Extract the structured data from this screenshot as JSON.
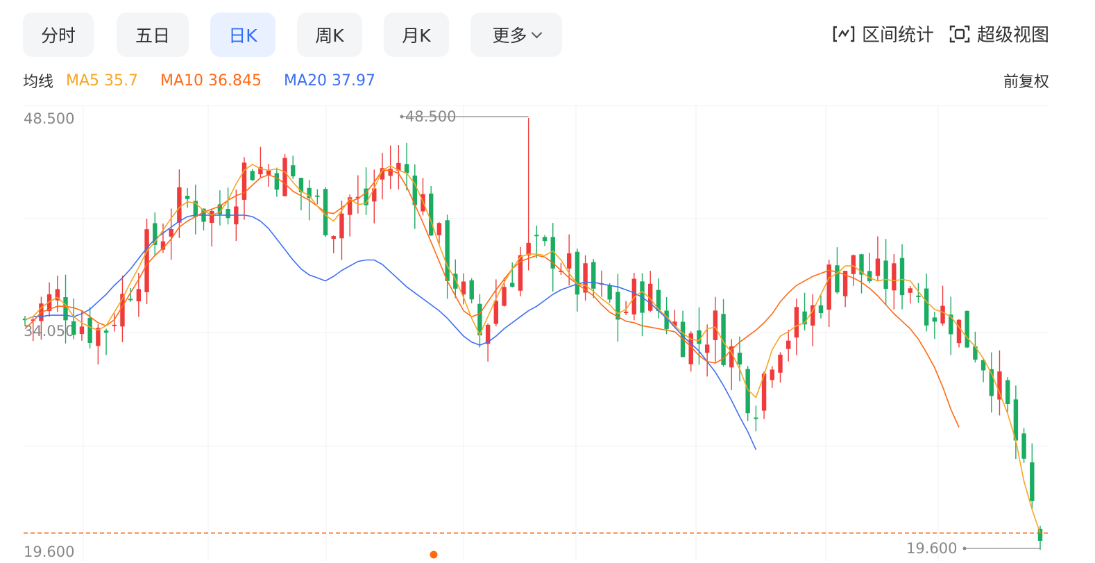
{
  "tabs": [
    {
      "label": "分时",
      "active": false
    },
    {
      "label": "五日",
      "active": false
    },
    {
      "label": "日K",
      "active": true
    },
    {
      "label": "周K",
      "active": false
    },
    {
      "label": "月K",
      "active": false
    },
    {
      "label": "更多",
      "active": false
    }
  ],
  "tools": {
    "range_stats": "区间统计",
    "super_view": "超级视图"
  },
  "legend": {
    "label": "均线",
    "ma5": "MA5 35.7",
    "ma10": "MA10 36.845",
    "ma20": "MA20 37.97"
  },
  "adjust_label": "前复权",
  "colors": {
    "up": "#ef3b3b",
    "down": "#1aad62",
    "ma5": "#f5a623",
    "ma10": "#ff6a13",
    "ma20": "#3e6ff2",
    "accent": "#2f6cf4",
    "dashed": "#ff6a13"
  },
  "chart_data": {
    "type": "candlestick",
    "y_tick_labels": [
      "48.500",
      "34.050",
      "19.600"
    ],
    "ylim": [
      19.6,
      48.5
    ],
    "high_label": "48.500",
    "low_label": "19.600",
    "reference_price": 20.72,
    "series": [
      {
        "name": "MA5",
        "values": [
          35.0,
          35.2,
          35.8,
          36.2,
          36.5,
          36.0,
          35.2,
          34.8,
          34.5,
          34.3,
          34.6,
          35.5,
          36.4,
          37.5,
          38.5,
          39.6,
          40.2,
          41.0,
          41.8,
          42.5,
          42.9,
          42.8,
          42.3,
          42.0,
          42.2,
          43.0,
          44.1,
          45.0,
          45.4,
          45.1,
          45.0,
          45.1,
          44.9,
          44.2,
          43.6,
          43.3,
          42.6,
          42.0,
          41.6,
          42.3,
          43.1,
          42.7,
          42.8,
          43.8,
          45.0,
          45.3,
          45.0,
          44.8,
          44.1,
          42.9,
          41.6,
          40.0,
          38.6,
          37.7,
          36.5,
          35.1,
          34.0,
          35.2,
          36.4,
          37.5,
          38.4,
          39.2,
          39.4,
          39.4,
          39.3,
          39.6,
          39.0,
          38.1,
          37.4,
          37.3,
          36.9,
          36.4,
          36.0,
          35.4,
          35.7,
          36.5,
          36.9,
          36.4,
          35.7,
          35.2,
          34.6,
          34.1,
          33.7,
          33.6,
          34.4,
          34.5,
          33.5,
          32.8,
          31.7,
          30.3,
          29.8,
          31.3,
          33.0,
          33.9,
          34.2,
          34.6,
          34.8,
          35.6,
          36.7,
          37.8,
          38.1,
          38.6,
          38.6,
          38.2,
          37.8,
          37.6,
          37.7,
          37.6,
          37.7,
          37.6,
          36.9,
          36.2,
          35.7,
          35.5,
          35.2,
          34.5,
          33.8,
          33.2,
          32.4,
          31.4,
          30.1,
          28.7,
          26.9,
          24.2,
          22.3,
          20.7
        ]
      },
      {
        "name": "MA10",
        "values": [
          34.4,
          34.9,
          35.5,
          35.7,
          35.9,
          35.9,
          35.8,
          35.6,
          35.2,
          34.8,
          34.6,
          35.0,
          35.9,
          36.8,
          37.7,
          38.7,
          39.3,
          39.8,
          40.4,
          41.2,
          41.6,
          41.9,
          42.2,
          42.4,
          42.6,
          43.0,
          43.3,
          43.5,
          44.0,
          44.5,
          44.7,
          44.5,
          44.1,
          43.6,
          43.3,
          43.0,
          42.6,
          42.2,
          42.1,
          42.5,
          42.9,
          43.1,
          43.5,
          44.2,
          45.0,
          45.0,
          44.8,
          43.9,
          42.7,
          41.5,
          40.2,
          38.9,
          37.6,
          36.6,
          35.6,
          35.2,
          35.4,
          36.2,
          37.0,
          37.7,
          38.4,
          38.9,
          39.1,
          39.3,
          39.2,
          38.8,
          38.3,
          37.8,
          37.4,
          37.0,
          36.6,
          36.0,
          35.5,
          35.2,
          34.9,
          34.8,
          34.6,
          34.5,
          34.4,
          34.3,
          34.2,
          33.7,
          33.2,
          32.6,
          32.2,
          32.1,
          32.4,
          33.0,
          33.5,
          33.9,
          34.3,
          34.8,
          35.4,
          36.2,
          36.8,
          37.3,
          37.6,
          37.9,
          38.1,
          38.3,
          38.2,
          38.0,
          37.8,
          37.5,
          37.1,
          36.6,
          36.0,
          35.4,
          34.9,
          34.4,
          33.7,
          32.8,
          31.8,
          30.5,
          29.0,
          27.8
        ]
      },
      {
        "name": "MA20",
        "values": [
          35.0,
          35.2,
          35.2,
          35.3,
          35.3,
          35.3,
          35.2,
          35.4,
          35.7,
          36.2,
          36.7,
          37.3,
          37.8,
          38.4,
          39.1,
          39.8,
          40.4,
          40.8,
          41.2,
          41.6,
          41.9,
          42.0,
          42.0,
          42.0,
          42.0,
          42.0,
          42.0,
          42.0,
          41.9,
          41.6,
          41.1,
          40.4,
          39.7,
          39.0,
          38.4,
          38.0,
          37.8,
          37.6,
          37.9,
          38.3,
          38.6,
          38.9,
          39.0,
          39.0,
          38.7,
          38.2,
          37.7,
          37.2,
          36.8,
          36.4,
          36.0,
          35.6,
          35.1,
          34.5,
          33.9,
          33.5,
          33.3,
          33.5,
          33.9,
          34.4,
          34.8,
          35.2,
          35.6,
          35.9,
          36.3,
          36.7,
          37.0,
          37.2,
          37.4,
          37.5,
          37.5,
          37.4,
          37.3,
          37.2,
          37.0,
          36.8,
          36.5,
          36.1,
          35.6,
          35.1,
          34.5,
          33.9,
          33.4,
          32.9,
          32.2,
          31.5,
          30.6,
          29.6,
          28.5,
          27.5,
          26.3
        ]
      }
    ]
  }
}
